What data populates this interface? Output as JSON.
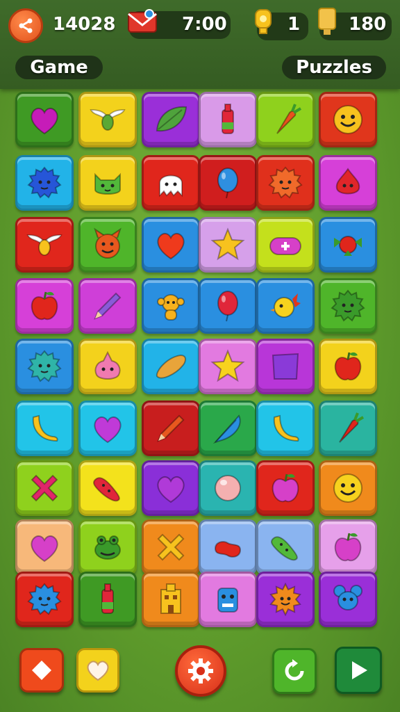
{
  "header": {
    "score": "14028",
    "timer": "7:00",
    "coins": "1",
    "trophies": "180",
    "mode_label": "Game",
    "category_label": "Puzzles"
  },
  "icons": {
    "menu": "share-icon",
    "mail": "mail-icon",
    "coin": "coin-icon",
    "trophy": "trophy-icon"
  },
  "board": {
    "rows": [
      [
        {
          "c": "#3f9a24",
          "i": "heart",
          "f": "#c61cb8"
        },
        {
          "c": "#f3d21c",
          "i": "wings",
          "f": "#5aa834"
        },
        {
          "c": "#9a2fd8",
          "i": "leaf",
          "f": "#4fa33c"
        },
        {
          "c": "#d99ae8",
          "i": "bottle",
          "f": "#e0263a"
        },
        {
          "c": "#8fd11d",
          "i": "carrot",
          "f": "#e8521e"
        },
        {
          "c": "#e0361c",
          "i": "face",
          "f": "#f7c21e"
        }
      ],
      [
        {
          "c": "#22b3e8",
          "i": "monster",
          "f": "#2656d8"
        },
        {
          "c": "#f3d21c",
          "i": "cat",
          "f": "#52b83a"
        },
        {
          "c": "#e0261c",
          "i": "ghost",
          "f": "#ffffff"
        },
        {
          "c": "#d01e1e",
          "i": "balloon",
          "f": "#2e8fe0"
        },
        {
          "c": "#e0301c",
          "i": "monster",
          "f": "#f06a2a"
        },
        {
          "c": "#d640d8",
          "i": "onion",
          "f": "#e0262a"
        }
      ],
      [
        {
          "c": "#e0261c",
          "i": "wings",
          "f": "#f7c21e"
        },
        {
          "c": "#4fb52a",
          "i": "devil",
          "f": "#e8581e"
        },
        {
          "c": "#2a8fe0",
          "i": "heart",
          "f": "#ef3a1c"
        },
        {
          "c": "#d6a0ea",
          "i": "star",
          "f": "#f7c21e"
        },
        {
          "c": "#c4e01c",
          "i": "gamepad",
          "f": "#d640c8"
        },
        {
          "c": "#2a8fe0",
          "i": "flower",
          "f": "#e0261c"
        }
      ],
      [
        {
          "c": "#d640d8",
          "i": "apple",
          "f": "#e0261c"
        },
        {
          "c": "#cf3fd8",
          "i": "pencil",
          "f": "#8a5ad8"
        },
        {
          "c": "#2a8fe0",
          "i": "monkey",
          "f": "#f7b21e"
        },
        {
          "c": "#2a8fe0",
          "i": "balloon",
          "f": "#e0263a"
        },
        {
          "c": "#2a8fe0",
          "i": "bird",
          "f": "#f7d21e"
        },
        {
          "c": "#4fb52a",
          "i": "monster",
          "f": "#3a9a2a"
        }
      ],
      [
        {
          "c": "#2a8fe0",
          "i": "monster",
          "f": "#2fb4a8"
        },
        {
          "c": "#f3d21c",
          "i": "blob",
          "f": "#f07ab0"
        },
        {
          "c": "#22b3e8",
          "i": "potato",
          "f": "#e8a43a"
        },
        {
          "c": "#e27ae0",
          "i": "star",
          "f": "#f7d21e"
        },
        {
          "c": "#b836d8",
          "i": "pillow",
          "f": "#8a3ad8"
        },
        {
          "c": "#f3d21c",
          "i": "apple",
          "f": "#e0261c"
        }
      ],
      [
        {
          "c": "#22c4e8",
          "i": "banana",
          "f": "#f7c21e"
        },
        {
          "c": "#22c4e8",
          "i": "heart",
          "f": "#c03ad8"
        },
        {
          "c": "#c81e1e",
          "i": "pencil",
          "f": "#e8581e"
        },
        {
          "c": "#2aa84a",
          "i": "feather",
          "f": "#2a8fe0"
        },
        {
          "c": "#22c4e8",
          "i": "banana",
          "f": "#f7c21e"
        },
        {
          "c": "#2ab4a0",
          "i": "carrot",
          "f": "#e0261c"
        }
      ],
      [
        {
          "c": "#8fd11d",
          "i": "cross",
          "f": "#e0266a"
        },
        {
          "c": "#f3e21c",
          "i": "pickle",
          "f": "#e0263a"
        },
        {
          "c": "#8a2fd8",
          "i": "heart",
          "f": "#b03ad8"
        },
        {
          "c": "#2ab4b0",
          "i": "orb",
          "f": "#f4b0b0"
        },
        {
          "c": "#e0261c",
          "i": "apple",
          "f": "#d640c8"
        },
        {
          "c": "#f08a1c",
          "i": "face",
          "f": "#f7d21e"
        }
      ],
      [
        {
          "c": "#f7b87a",
          "i": "heart",
          "f": "#d640c8"
        },
        {
          "c": "#8fd11d",
          "i": "frog",
          "f": "#3a9a2a"
        },
        {
          "c": "#f08a1c",
          "i": "cross",
          "f": "#f7c21e"
        },
        {
          "c": "#8ab4f0",
          "i": "bean",
          "f": "#e0261c"
        },
        {
          "c": "#8ab4f0",
          "i": "pickle",
          "f": "#52b83a"
        },
        {
          "c": "#e6a0ea",
          "i": "apple",
          "f": "#d640c8"
        }
      ],
      [
        {
          "c": "#e0261c",
          "i": "monster",
          "f": "#2a8fe0"
        },
        {
          "c": "#3f9a24",
          "i": "bottle",
          "f": "#e0263a"
        },
        {
          "c": "#f08a1c",
          "i": "building",
          "f": "#f7c21e"
        },
        {
          "c": "#e27ae0",
          "i": "robot",
          "f": "#2a8fe0"
        },
        {
          "c": "#9a2fd8",
          "i": "sun",
          "f": "#f08a1c"
        },
        {
          "c": "#9a2fd8",
          "i": "mouse",
          "f": "#2a8fe0"
        }
      ]
    ]
  },
  "bottom_bar": [
    {
      "name": "diamond-button",
      "icon": "diamond-icon",
      "color": "#ef4a1c"
    },
    {
      "name": "heart-button",
      "icon": "heart-icon",
      "color": "#f3d21c"
    },
    {
      "name": "settings-button",
      "icon": "gear-icon",
      "color": "#e0361c"
    },
    {
      "name": "refresh-button",
      "icon": "refresh-icon",
      "color": "#4fb52a"
    },
    {
      "name": "play-button",
      "icon": "play-icon",
      "color": "#1f8a3a"
    }
  ]
}
